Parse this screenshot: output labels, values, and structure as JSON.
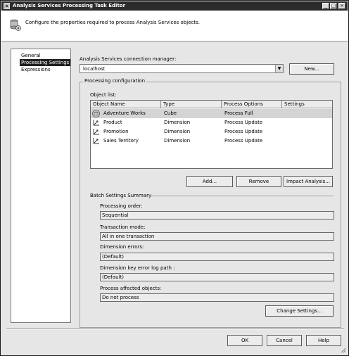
{
  "window": {
    "title": "Analysis Services Processing Task Editor",
    "minimize_glyph": "_",
    "maximize_glyph": "□",
    "close_glyph": "×"
  },
  "header": {
    "text": "Configure the properties required to process Analysis Services objects.",
    "icon": "processing-task-icon"
  },
  "nav": {
    "items": [
      {
        "label": "General",
        "selected": false
      },
      {
        "label": "Processing Settings",
        "selected": true
      },
      {
        "label": "Expressions",
        "selected": false
      }
    ]
  },
  "connection": {
    "label": "Analysis Services connection manager:",
    "value": "localhost",
    "new_button": "New..."
  },
  "processing_config": {
    "group_title": "Processing configuration",
    "object_list_label": "Object list:",
    "columns": [
      "Object Name",
      "Type",
      "Process Options",
      "Settings"
    ],
    "rows": [
      {
        "name": "Adventure Works",
        "type": "Cube",
        "process": "Process Full",
        "settings": "",
        "icon": "cube-icon"
      },
      {
        "name": "Product",
        "type": "Dimension",
        "process": "Process Update",
        "settings": "",
        "icon": "dimension-icon"
      },
      {
        "name": "Promotion",
        "type": "Dimension",
        "process": "Process Update",
        "settings": "",
        "icon": "dimension-icon"
      },
      {
        "name": "Sales Territory",
        "type": "Dimension",
        "process": "Process Update",
        "settings": "",
        "icon": "dimension-icon"
      }
    ],
    "buttons": {
      "add": "Add...",
      "remove": "Remove",
      "impact": "Impact Analysis..."
    }
  },
  "batch": {
    "title": "Batch Settings Summary",
    "processing_order_label": "Processing order:",
    "processing_order_value": "Sequential",
    "transaction_mode_label": "Transaction mode:",
    "transaction_mode_value": "All in one transaction",
    "dimension_errors_label": "Dimension errors:",
    "dimension_errors_value": "(Default)",
    "key_error_log_label": "Dimension key error log path :",
    "key_error_log_value": "(Default)",
    "affected_label": "Process affected objects:",
    "affected_value": "Do not process",
    "change_button": "Change Settings..."
  },
  "footer": {
    "ok": "OK",
    "cancel": "Cancel",
    "help": "Help"
  }
}
